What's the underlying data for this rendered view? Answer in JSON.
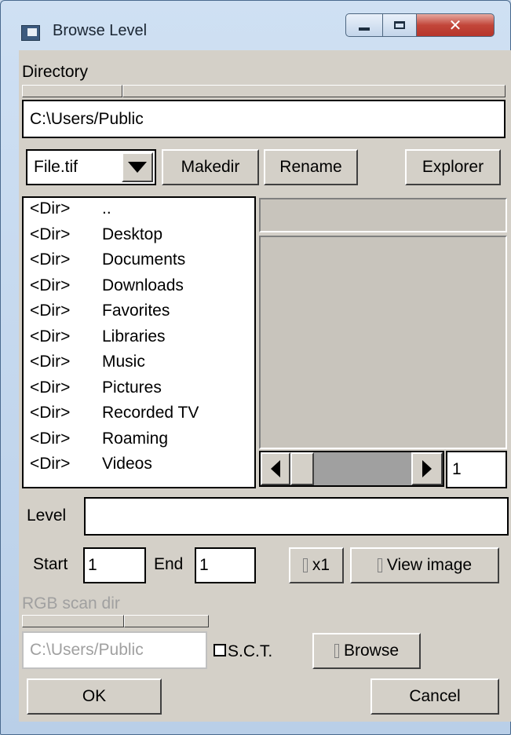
{
  "window": {
    "title": "Browse Level"
  },
  "directory": {
    "label": "Directory",
    "path": "C:\\Users/Public"
  },
  "toolbar": {
    "filter_selected": "File.tif",
    "makedir_label": "Makedir",
    "rename_label": "Rename",
    "explorer_label": "Explorer"
  },
  "file_list": [
    {
      "tag": "<Dir>",
      "name": ".."
    },
    {
      "tag": "<Dir>",
      "name": "Desktop"
    },
    {
      "tag": "<Dir>",
      "name": "Documents"
    },
    {
      "tag": "<Dir>",
      "name": "Downloads"
    },
    {
      "tag": "<Dir>",
      "name": "Favorites"
    },
    {
      "tag": "<Dir>",
      "name": "Libraries"
    },
    {
      "tag": "<Dir>",
      "name": "Music"
    },
    {
      "tag": "<Dir>",
      "name": "Pictures"
    },
    {
      "tag": "<Dir>",
      "name": "Recorded TV"
    },
    {
      "tag": "<Dir>",
      "name": "Roaming"
    },
    {
      "tag": "<Dir>",
      "name": "Videos"
    }
  ],
  "preview": {
    "page_value": "1"
  },
  "level": {
    "label": "Level",
    "value": ""
  },
  "range": {
    "start_label": "Start",
    "start_value": "1",
    "end_label": "End",
    "end_value": "1",
    "x1_label": "x1",
    "view_image_label": "View image"
  },
  "rgb_scan": {
    "label": "RGB scan dir",
    "path": "C:\\Users/Public",
    "sct_label": "S.C.T.",
    "browse_label": "Browse"
  },
  "footer": {
    "ok_label": "OK",
    "cancel_label": "Cancel"
  }
}
